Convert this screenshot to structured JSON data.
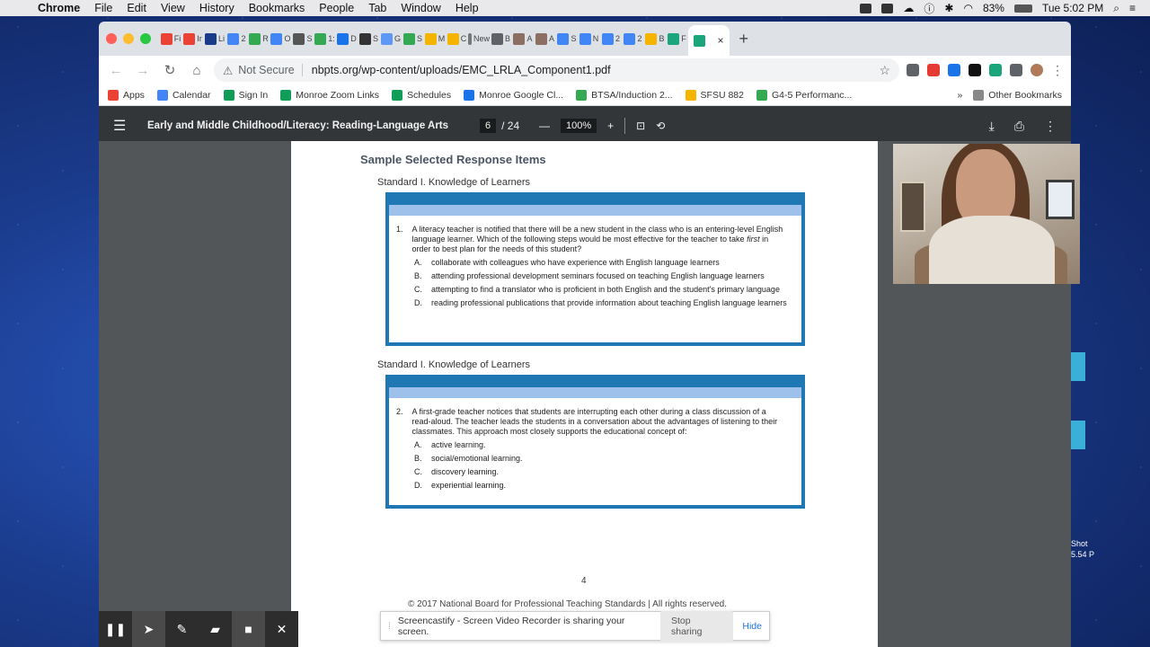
{
  "menubar": {
    "app_name": "Chrome",
    "items": [
      "File",
      "Edit",
      "View",
      "History",
      "Bookmarks",
      "People",
      "Tab",
      "Window",
      "Help"
    ],
    "battery": "83%",
    "clock": "Tue 5:02 PM"
  },
  "tabs": [
    {
      "icon": "gmail-icon",
      "label": "Fi",
      "color": "#ea4335"
    },
    {
      "icon": "gmail-icon",
      "label": "Ir",
      "color": "#ea4335"
    },
    {
      "icon": "paypal-icon",
      "label": "Li",
      "color": "#1a3a8a"
    },
    {
      "icon": "docs-icon",
      "label": "2",
      "color": "#4285f4"
    },
    {
      "icon": "drive-icon",
      "label": "R",
      "color": "#34a853"
    },
    {
      "icon": "docs-icon",
      "label": "O",
      "color": "#4285f4"
    },
    {
      "icon": "h-icon",
      "label": "S",
      "color": "#555555"
    },
    {
      "icon": "drive-icon",
      "label": "1:",
      "color": "#34a853"
    },
    {
      "icon": "bank-icon",
      "label": "D",
      "color": "#1a73e8"
    },
    {
      "icon": "w-icon",
      "label": "S",
      "color": "#333333"
    },
    {
      "icon": "cloud-icon",
      "label": "G",
      "color": "#5e97f6"
    },
    {
      "icon": "drive-icon",
      "label": "S",
      "color": "#34a853"
    },
    {
      "icon": "slides-icon",
      "label": "M",
      "color": "#f4b400"
    },
    {
      "icon": "slides-icon",
      "label": "C",
      "color": "#f4b400"
    },
    {
      "icon": "new-icon",
      "label": "New",
      "color": "#777777"
    },
    {
      "icon": "chrome-icon",
      "label": "B",
      "color": "#5f6368"
    },
    {
      "icon": "image-icon",
      "label": "A",
      "color": "#8d6e63"
    },
    {
      "icon": "image-icon",
      "label": "A",
      "color": "#8d6e63"
    },
    {
      "icon": "calendar-icon",
      "label": "S",
      "color": "#4285f4"
    },
    {
      "icon": "docs-icon",
      "label": "N",
      "color": "#4285f4"
    },
    {
      "icon": "docs-icon",
      "label": "2",
      "color": "#4285f4"
    },
    {
      "icon": "docs-icon",
      "label": "2",
      "color": "#4285f4"
    },
    {
      "icon": "slides-icon",
      "label": "B",
      "color": "#f4b400"
    },
    {
      "icon": "n-icon",
      "label": "F",
      "color": "#1aa67a"
    },
    {
      "icon": "n-icon",
      "label": "",
      "color": "#1aa67a",
      "active": true
    }
  ],
  "omnibox": {
    "security": "Not Secure",
    "url": "nbpts.org/wp-content/uploads/EMC_LRLA_Component1.pdf"
  },
  "bookmarks": [
    {
      "icon": "apps-icon",
      "label": "Apps",
      "color": "#ea4335"
    },
    {
      "icon": "calendar-icon",
      "label": "Calendar",
      "color": "#4285f4"
    },
    {
      "icon": "sheets-icon",
      "label": "Sign In",
      "color": "#0f9d58"
    },
    {
      "icon": "sheets-icon",
      "label": "Monroe Zoom Links",
      "color": "#0f9d58"
    },
    {
      "icon": "sheets-icon",
      "label": "Schedules",
      "color": "#0f9d58"
    },
    {
      "icon": "contact-icon",
      "label": "Monroe Google Cl...",
      "color": "#1a73e8"
    },
    {
      "icon": "drive-icon",
      "label": "BTSA/Induction 2...",
      "color": "#34a853"
    },
    {
      "icon": "sfsu-icon",
      "label": "SFSU 882",
      "color": "#f4b400"
    },
    {
      "icon": "drive-icon",
      "label": "G4-5 Performanc...",
      "color": "#34a853"
    }
  ],
  "other_bookmarks": "Other Bookmarks",
  "pdf": {
    "title": "Early and Middle Childhood/Literacy: Reading-Language Arts",
    "page_current": "6",
    "page_total": "/ 24",
    "zoom": "100%",
    "section_heading": "Sample Selected Response Items",
    "questions": [
      {
        "standard": "Standard I. Knowledge of Learners",
        "number": "1.",
        "stem_before": "A literacy teacher is notified that there will be a new student in the class who is an entering-level English language learner. Which of the following steps would be most effective for the teacher to take ",
        "stem_emph": "first",
        "stem_after": " in order to best plan for the needs of this student?",
        "options": [
          {
            "letter": "A.",
            "text": "collaborate with colleagues who have experience with English language learners"
          },
          {
            "letter": "B.",
            "text": "attending professional development seminars focused on teaching English language learners"
          },
          {
            "letter": "C.",
            "text": "attempting to find a translator who is proficient in both English and the student's primary language"
          },
          {
            "letter": "D.",
            "text": "reading professional publications that provide information about teaching English language learners"
          }
        ]
      },
      {
        "standard": "Standard I. Knowledge of Learners",
        "number": "2.",
        "stem_before": "A first-grade teacher notices that students are interrupting each other during a class discussion of a read-aloud. The teacher leads the students in a conversation about the advantages of listening to their classmates. This approach most closely supports the educational concept of:",
        "stem_emph": "",
        "stem_after": "",
        "options": [
          {
            "letter": "A.",
            "text": "active learning."
          },
          {
            "letter": "B.",
            "text": "social/emotional learning."
          },
          {
            "letter": "C.",
            "text": "discovery learning."
          },
          {
            "letter": "D.",
            "text": "experiential learning."
          }
        ]
      }
    ],
    "page_number": "4",
    "copyright": "© 2017 National Board for Professional Teaching Standards | All rights reserved."
  },
  "screencastify": {
    "message": "Screencastify - Screen Video Recorder is sharing your screen.",
    "stop_label": "Stop sharing",
    "hide_label": "Hide"
  },
  "desktop": {
    "label_a": "Shot",
    "label_b": "5.54 P"
  }
}
